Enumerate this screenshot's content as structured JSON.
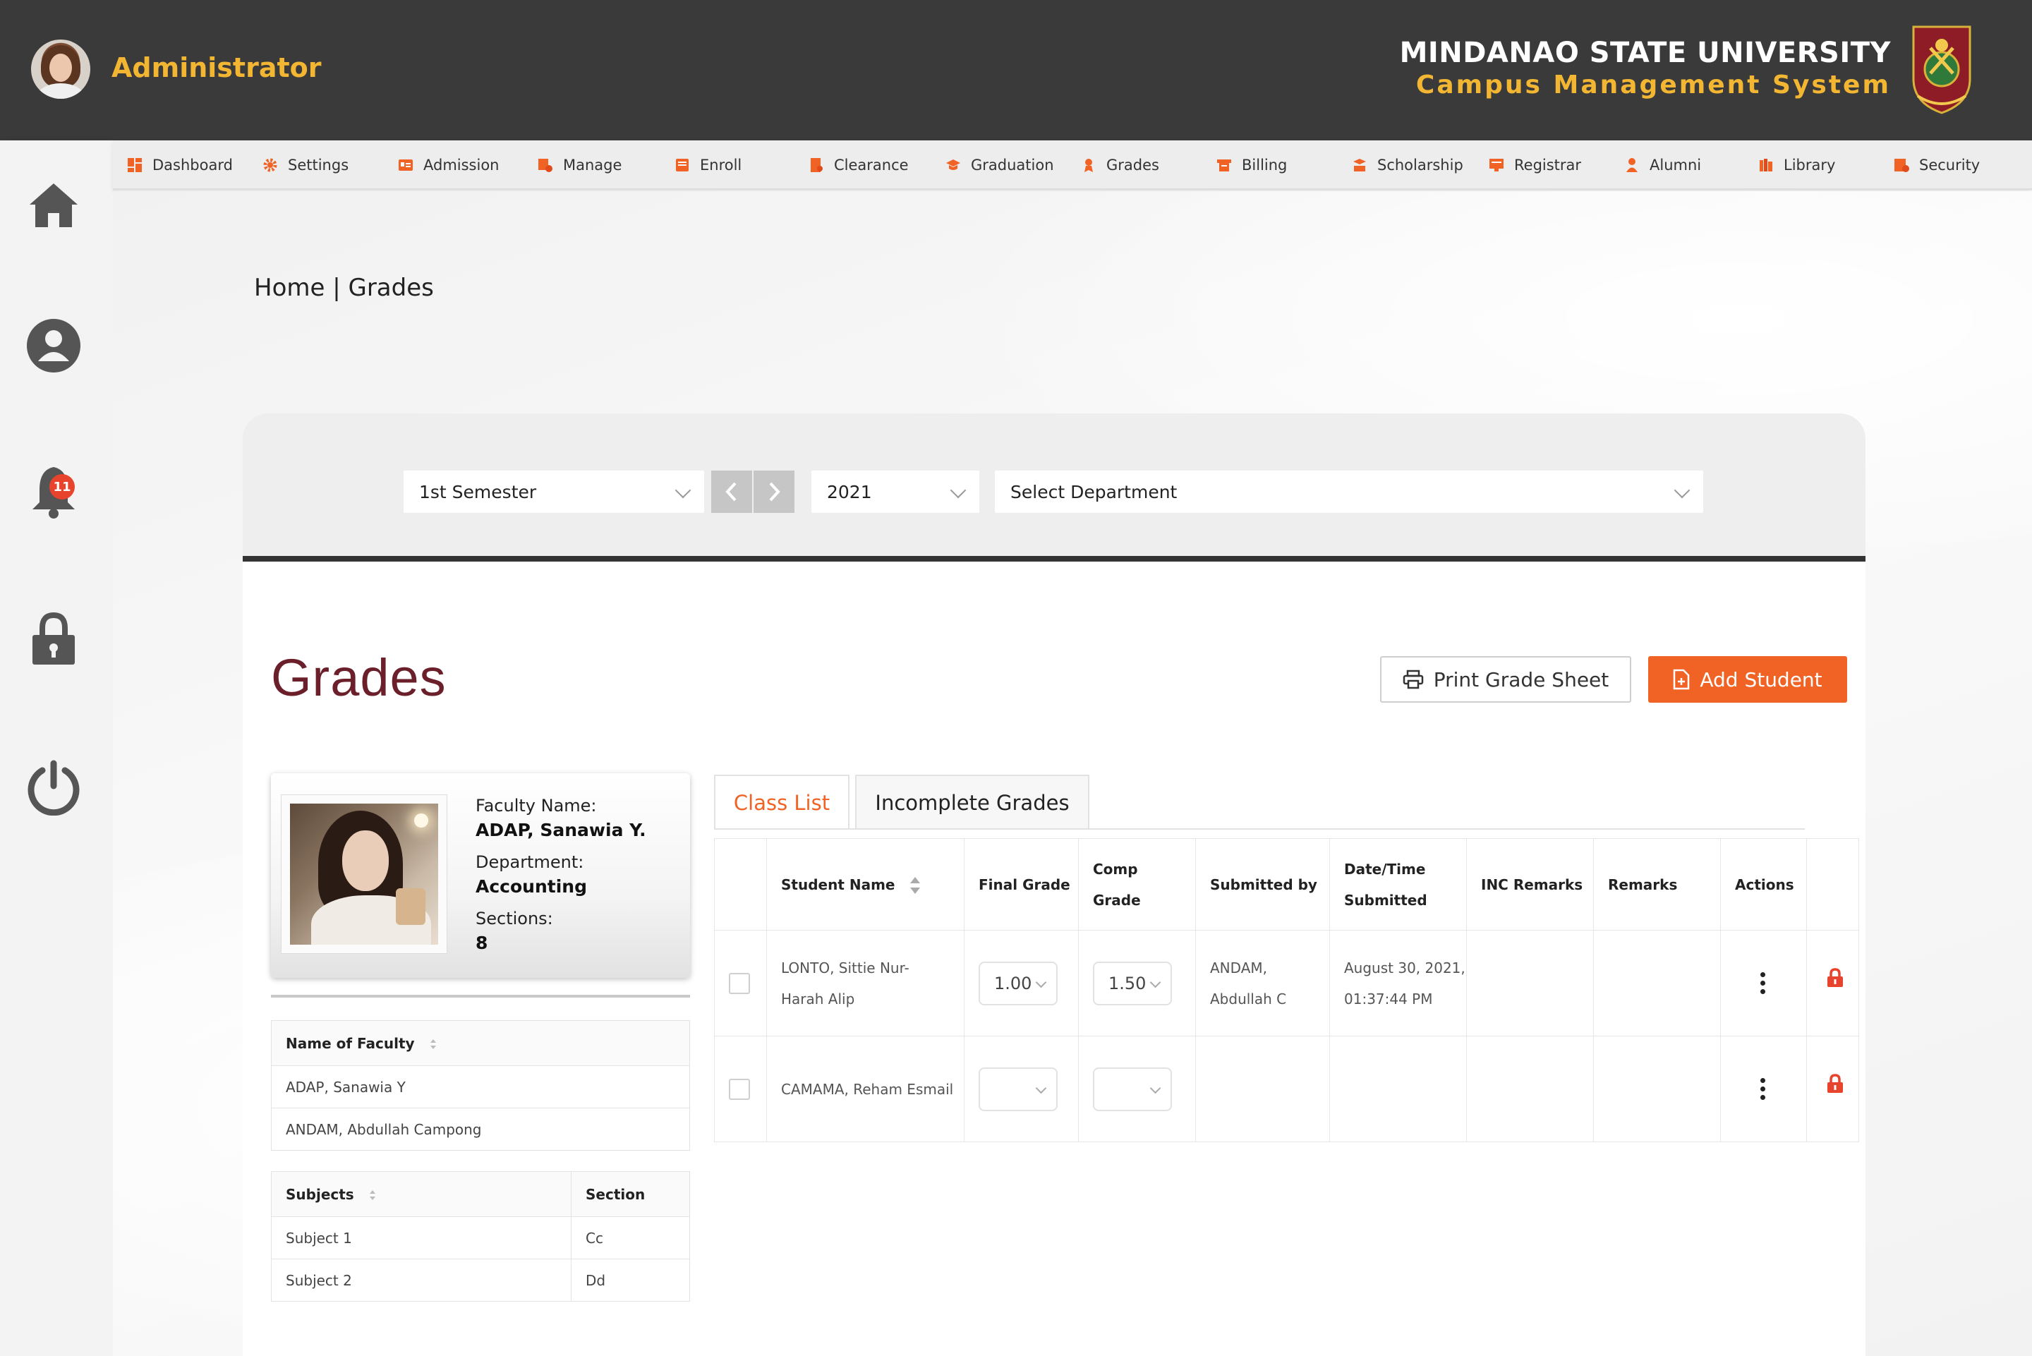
{
  "header": {
    "user_name": "Administrator",
    "university": "MINDANAO STATE UNIVERSITY",
    "system_name": "Campus Management System"
  },
  "notifications": {
    "count": "11"
  },
  "menu": [
    {
      "label": "Dashboard",
      "icon": "dashboard-icon"
    },
    {
      "label": "Settings",
      "icon": "gear-icon"
    },
    {
      "label": "Admission",
      "icon": "id-card-icon"
    },
    {
      "label": "Manage",
      "icon": "manage-icon"
    },
    {
      "label": "Enroll",
      "icon": "enroll-icon"
    },
    {
      "label": "Clearance",
      "icon": "clearance-icon"
    },
    {
      "label": "Graduation",
      "icon": "graduation-cap-icon"
    },
    {
      "label": "Grades",
      "icon": "grades-icon"
    },
    {
      "label": "Billing",
      "icon": "billing-icon"
    },
    {
      "label": "Scholarship",
      "icon": "scholarship-icon"
    },
    {
      "label": "Registrar",
      "icon": "registrar-icon"
    },
    {
      "label": "Alumni",
      "icon": "alumni-icon"
    },
    {
      "label": "Library",
      "icon": "library-icon"
    },
    {
      "label": "Security",
      "icon": "security-icon"
    }
  ],
  "breadcrumb": "Home | Grades",
  "filters": {
    "semester": "1st Semester",
    "year": "2021",
    "department": "Select Department"
  },
  "page_title": "Grades",
  "buttons": {
    "print": "Print Grade Sheet",
    "add_student": "Add Student"
  },
  "faculty": {
    "name_label": "Faculty Name:",
    "name": "ADAP, Sanawia Y.",
    "department_label": "Department:",
    "department": "Accounting",
    "sections_label": "Sections:",
    "sections": "8"
  },
  "faculty_table": {
    "header": "Name of Faculty",
    "rows": [
      "ADAP, Sanawia Y",
      "ANDAM, Abdullah Campong"
    ]
  },
  "subjects_table": {
    "headers": [
      "Subjects",
      "Section"
    ],
    "rows": [
      [
        "Subject 1",
        "Cc"
      ],
      [
        "Subject 2",
        "Dd"
      ]
    ]
  },
  "tabs": [
    "Class List",
    "Incomplete Grades"
  ],
  "grid": {
    "headers": {
      "student_name": "Student Name",
      "final_grade": "Final Grade",
      "comp_grade_1": "Comp",
      "comp_grade_2": "Grade",
      "submitted_by": "Submitted by",
      "datetime_1": "Date/Time",
      "datetime_2": "Submitted",
      "inc_remarks": "INC Remarks",
      "remarks": "Remarks",
      "actions": "Actions"
    },
    "rows": [
      {
        "name_1": "LONTO, Sittie Nur-",
        "name_2": "Harah Alip",
        "final_grade": "1.00",
        "comp_grade": "1.50",
        "submitted_by_1": "ANDAM,",
        "submitted_by_2": "Abdullah C",
        "date_1": "August 30, 2021,",
        "date_2": "01:37:44 PM",
        "inc_remarks": "",
        "remarks": ""
      },
      {
        "name_1": "CAMAMA, Reham Esmail",
        "name_2": "",
        "final_grade": "",
        "comp_grade": "",
        "submitted_by_1": "",
        "submitted_by_2": "",
        "date_1": "",
        "date_2": "",
        "inc_remarks": "",
        "remarks": ""
      }
    ]
  },
  "colors": {
    "accent": "#f16325",
    "header_bg": "#3a3a3a",
    "gold": "#f2b632",
    "title_maroon": "#6b1f2a"
  }
}
